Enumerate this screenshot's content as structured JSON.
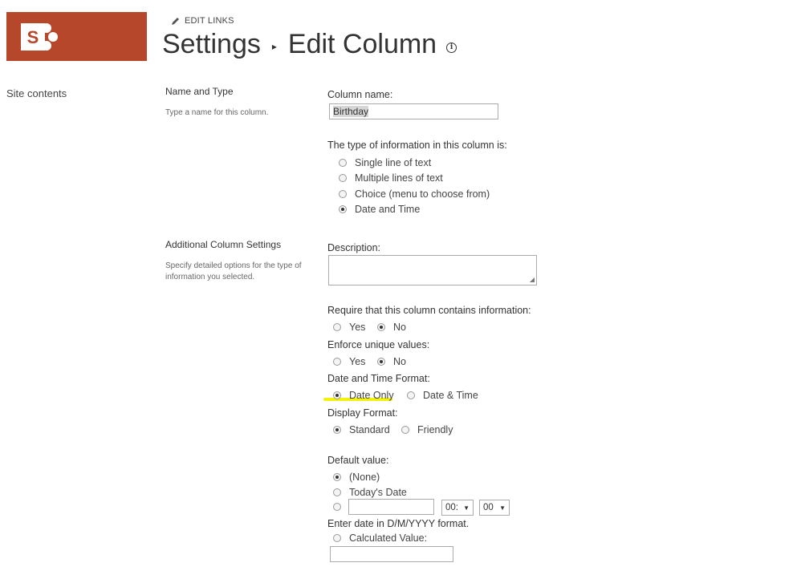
{
  "header": {
    "edit_links": "EDIT LINKS",
    "title_part1": "Settings",
    "title_part2": "Edit Column",
    "logo_letter": "S",
    "brand_color": "#b7472a"
  },
  "nav": {
    "site_contents": "Site contents"
  },
  "section_name_type": {
    "title": "Name and Type",
    "desc": "Type a name for this column.",
    "column_name_label": "Column name:",
    "column_name_value": "Birthday",
    "type_label": "The type of information in this column is:",
    "types": [
      {
        "label": "Single line of text",
        "checked": false
      },
      {
        "label": "Multiple lines of text",
        "checked": false
      },
      {
        "label": "Choice (menu to choose from)",
        "checked": false
      },
      {
        "label": "Date and Time",
        "checked": true
      }
    ]
  },
  "section_additional": {
    "title": "Additional Column Settings",
    "desc": "Specify detailed options for the type of information you selected.",
    "description_label": "Description:",
    "require_label": "Require that this column contains information:",
    "require_yes": "Yes",
    "require_no": "No",
    "unique_label": "Enforce unique values:",
    "unique_yes": "Yes",
    "unique_no": "No",
    "format_label": "Date and Time Format:",
    "format_date_only": "Date Only",
    "format_date_time": "Date & Time",
    "display_label": "Display Format:",
    "display_standard": "Standard",
    "display_friendly": "Friendly",
    "default_label": "Default value:",
    "default_none": "(None)",
    "default_today": "Today's Date",
    "hour_value": "00:",
    "minute_value": "00",
    "date_hint": "Enter date in D/M/YYYY format.",
    "calculated_label": "Calculated Value:",
    "highlight_color": "#f2f20a"
  }
}
